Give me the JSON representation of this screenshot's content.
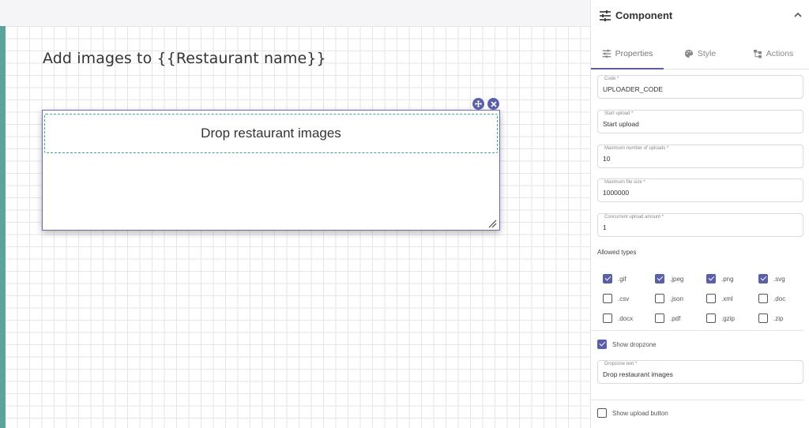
{
  "canvas": {
    "heading": "Add images to {{Restaurant name}}",
    "uploader": {
      "dropzone_text": "Drop restaurant images"
    }
  },
  "panel": {
    "title": "Component",
    "tabs": [
      {
        "label": "Properties",
        "active": true
      },
      {
        "label": "Style",
        "active": false
      },
      {
        "label": "Actions",
        "active": false
      }
    ],
    "fields": {
      "code": {
        "label": "Code *",
        "value": "UPLOADER_CODE"
      },
      "start_upload": {
        "label": "Start upload *",
        "value": "Start upload"
      },
      "max_uploads": {
        "label": "Maximum number of uploads *",
        "value": "10"
      },
      "max_file_size": {
        "label": "Maximum file size *",
        "value": "1000000"
      },
      "concurrent": {
        "label": "Concurrent upload amount *",
        "value": "1"
      }
    },
    "allowed_types_label": "Allowed types",
    "types": [
      {
        "label": ".gif",
        "checked": true
      },
      {
        "label": ".jpeg",
        "checked": true
      },
      {
        "label": ".png",
        "checked": true
      },
      {
        "label": ".svg",
        "checked": true
      },
      {
        "label": ".csv",
        "checked": false
      },
      {
        "label": ".json",
        "checked": false
      },
      {
        "label": ".xml",
        "checked": false
      },
      {
        "label": ".doc",
        "checked": false
      },
      {
        "label": ".docx",
        "checked": false
      },
      {
        "label": ".pdf",
        "checked": false
      },
      {
        "label": ".gzip",
        "checked": false
      },
      {
        "label": ".zip",
        "checked": false
      }
    ],
    "show_dropzone": {
      "label": "Show dropzone",
      "checked": true
    },
    "dropzone_text_field": {
      "label": "Dropzone text *",
      "value": "Drop restaurant images"
    },
    "show_upload_button": {
      "label": "Show upload button",
      "checked": false
    }
  },
  "colors": {
    "accent": "#5b5fa8",
    "left_bar": "#5aa49a",
    "dropzone_border": "#3ea696"
  },
  "icons": {
    "panel_header": "sliders-icon",
    "collapse": "chevron-up-icon",
    "tab_properties": "sliders-icon",
    "tab_style": "palette-icon",
    "tab_actions": "flow-icon",
    "move": "move-icon",
    "close": "close-icon",
    "resize": "resize-handle-icon"
  }
}
